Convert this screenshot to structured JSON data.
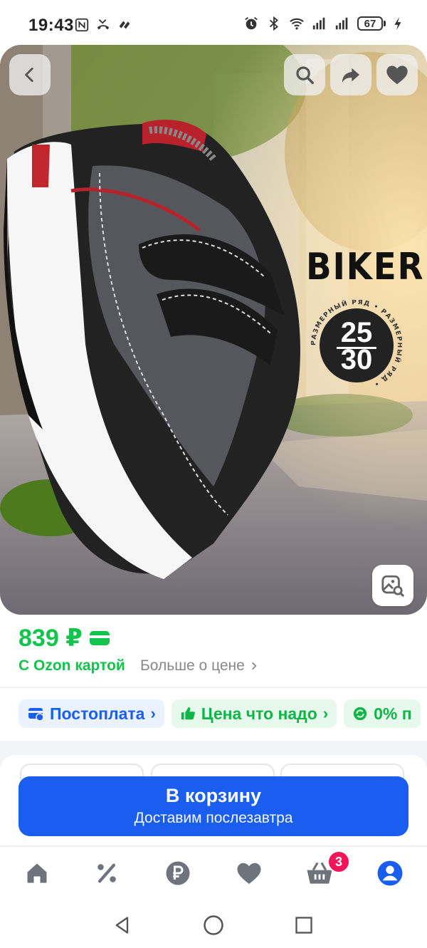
{
  "status_bar": {
    "time": "19:43",
    "battery": "67",
    "icons": [
      "nfc-icon",
      "missed-call-icon",
      "ozon-notification-icon",
      "alarm-icon",
      "bluetooth-icon",
      "wifi-icon",
      "signal-icon",
      "signal-icon",
      "charging-icon"
    ]
  },
  "product": {
    "brand_text": "BIKER",
    "size_badge": {
      "top": "25",
      "bottom": "30",
      "ring_text": "РАЗМЕРНЫЙ РЯД • РАЗМЕРНЫЙ РЯД • "
    },
    "image_icons": [
      "back-arrow-icon",
      "search-icon",
      "share-icon",
      "heart-icon",
      "image-search-icon"
    ]
  },
  "price": {
    "value": "839 ₽",
    "ozon_card_label": "С Ozon картой",
    "more_price_label": "Больше о цене",
    "color": "#10c44c"
  },
  "chips": [
    {
      "label": "Постоплата",
      "icon": "postpay-icon"
    },
    {
      "label": "Цена что надо",
      "icon": "thumbs-up-icon"
    },
    {
      "label": "0% п",
      "icon": "installment-icon"
    }
  ],
  "cart_button": {
    "title": "В корзину",
    "subtitle": "Доставим послезавтра",
    "color": "#1a5ef0"
  },
  "bottom_nav": {
    "items": [
      "home-icon",
      "discount-icon",
      "ruble-icon",
      "favorites-icon",
      "cart-icon",
      "profile-icon"
    ],
    "cart_badge": "3",
    "active": "profile-icon"
  },
  "system_nav": [
    "back-triangle-icon",
    "home-circle-icon",
    "recents-square-icon"
  ]
}
